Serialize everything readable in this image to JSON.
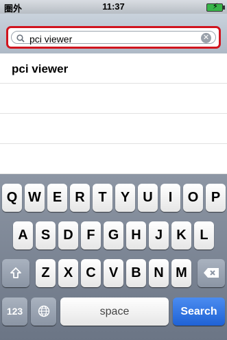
{
  "status": {
    "carrier": "圏外",
    "time": "11:37"
  },
  "search": {
    "value": "pci viewer"
  },
  "suggestions": [
    "pci viewer"
  ],
  "keyboard": {
    "row1": [
      "Q",
      "W",
      "E",
      "R",
      "T",
      "Y",
      "U",
      "I",
      "O",
      "P"
    ],
    "row2": [
      "A",
      "S",
      "D",
      "F",
      "G",
      "H",
      "J",
      "K",
      "L"
    ],
    "row3": [
      "Z",
      "X",
      "C",
      "V",
      "B",
      "N",
      "M"
    ],
    "numbers": "123",
    "space": "space",
    "search": "Search"
  },
  "colors": {
    "search_key": "#1f62d5",
    "highlight_border": "#d0141e"
  }
}
